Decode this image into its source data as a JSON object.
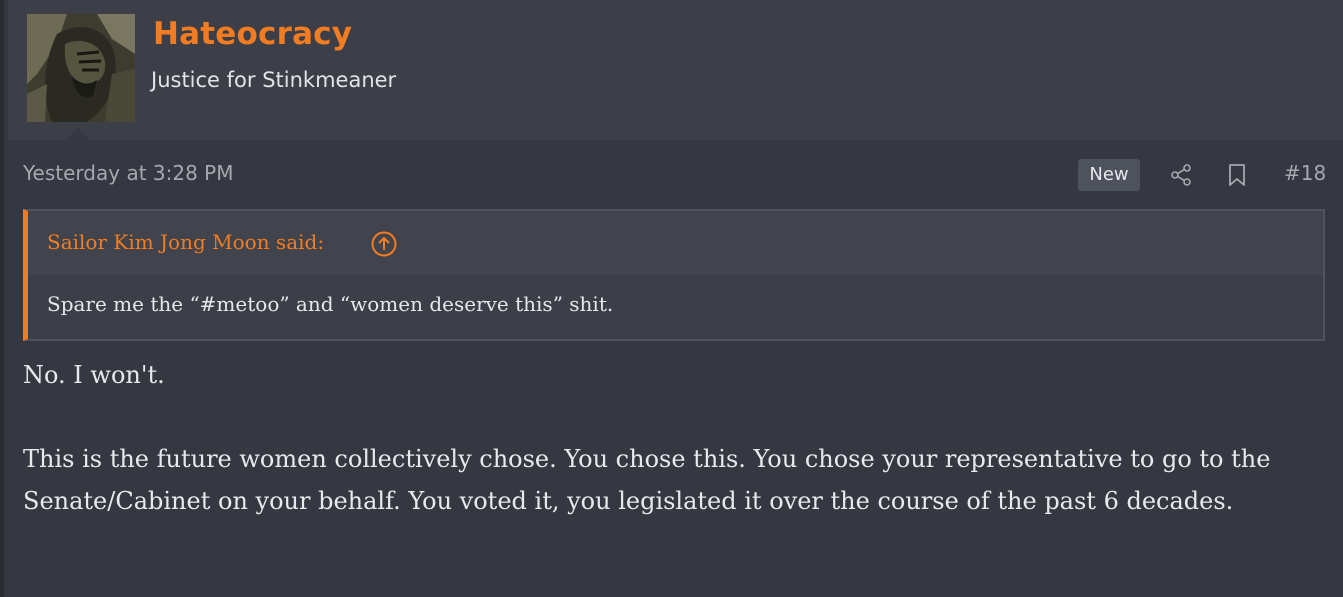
{
  "user": {
    "name": "Hateocracy",
    "title": "Justice for Stinkmeaner"
  },
  "meta": {
    "timestamp": "Yesterday at 3:28 PM",
    "new_badge": "New",
    "post_number": "#18",
    "icons": [
      "share-icon",
      "bookmark-icon"
    ]
  },
  "quote": {
    "author_said": "Sailor Kim Jong Moon said:",
    "icon": "arrow-up-circle-icon",
    "text": "Spare me the “#metoo” and “women deserve this” shit."
  },
  "message": {
    "paragraph1": "No. I won't.",
    "paragraph2": "This is the future women collectively chose. You chose this. You chose your representative to go to the Senate/Cabinet on your behalf. You voted it, you legislated it over the course of the past 6 decades."
  },
  "colors": {
    "accent": "#f27c21",
    "background": "#353841",
    "header_bg": "#3c3f48",
    "text": "#e8e9ec",
    "muted": "#a5a8ae"
  }
}
